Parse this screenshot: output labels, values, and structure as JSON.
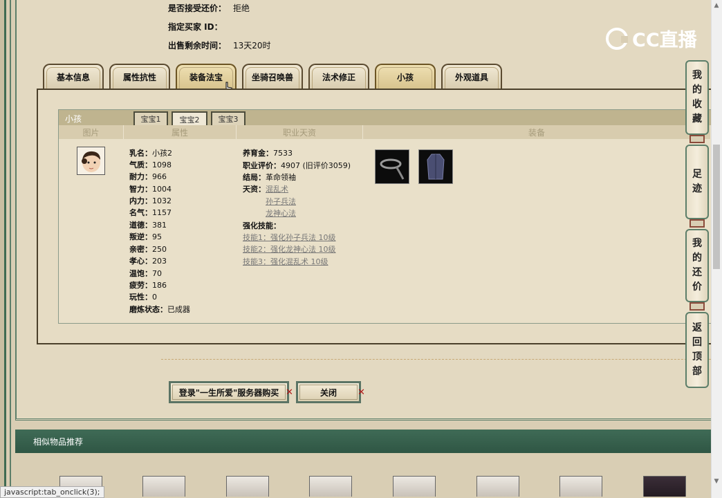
{
  "info": {
    "accept_counter_label": "是否接受还价：",
    "accept_counter_value": "拒绝",
    "buyer_id_label": "指定买家 ID：",
    "buyer_id_value": "",
    "time_left_label": "出售剩余时间：",
    "time_left_value": "13天20时"
  },
  "logo": {
    "text": "CC直播"
  },
  "tabs": [
    {
      "label": "基本信息",
      "active": false
    },
    {
      "label": "属性抗性",
      "active": false
    },
    {
      "label": "装备法宝",
      "active": true
    },
    {
      "label": "坐骑召唤兽",
      "active": false
    },
    {
      "label": "法术修正",
      "active": false
    },
    {
      "label": "小孩",
      "active": true
    },
    {
      "label": "外观道具",
      "active": false
    }
  ],
  "child_panel": {
    "title": "小孩",
    "subtabs": [
      {
        "label": "宝宝1",
        "active": false
      },
      {
        "label": "宝宝2",
        "active": true
      },
      {
        "label": "宝宝3",
        "active": false
      }
    ],
    "columns": [
      "图片",
      "属性",
      "职业天资",
      "装备"
    ],
    "attributes": [
      {
        "label": "乳名：",
        "value": "小孩2"
      },
      {
        "label": "气质：",
        "value": "1098"
      },
      {
        "label": "耐力：",
        "value": "966"
      },
      {
        "label": "智力：",
        "value": "1004"
      },
      {
        "label": "内力：",
        "value": "1032"
      },
      {
        "label": "名气：",
        "value": "1157"
      },
      {
        "label": "道德：",
        "value": "381"
      },
      {
        "label": "叛逆：",
        "value": "95"
      },
      {
        "label": "亲密：",
        "value": "250"
      },
      {
        "label": "孝心：",
        "value": "203"
      },
      {
        "label": "温饱：",
        "value": "70"
      },
      {
        "label": "疲劳：",
        "value": "186"
      },
      {
        "label": "玩性：",
        "value": "0"
      },
      {
        "label": "磨炼状态：",
        "value": "已成器"
      }
    ],
    "career": {
      "upbringing_label": "养育金：",
      "upbringing_value": "7533",
      "rating_label": "职业评价：",
      "rating_value": "4907 (旧评价3059)",
      "ending_label": "结局：",
      "ending_value": "革命领袖",
      "talent_label": "天资：",
      "talents": [
        "混乱术",
        "孙子兵法",
        "龙神心法"
      ],
      "skills_label": "强化技能：",
      "skills": [
        "技能1：强化孙子兵法 10级",
        "技能2：强化龙神心法 10级",
        "技能3：强化混乱术 10级"
      ]
    },
    "equipment": [
      {
        "icon": "belt-icon"
      },
      {
        "icon": "robe-icon"
      }
    ]
  },
  "buttons": {
    "login_buy": "登录\"一生所爱\"服务器购买",
    "close": "关闭"
  },
  "similar": {
    "title": "相似物品推荐"
  },
  "side_nav": [
    {
      "label": "我的收藏",
      "chars": [
        "我",
        "的",
        "收",
        "藏"
      ]
    },
    {
      "label": "足迹",
      "chars": [
        "足",
        "迹"
      ]
    },
    {
      "label": "我的还价",
      "chars": [
        "我",
        "的",
        "还",
        "价"
      ]
    },
    {
      "label": "返回顶部",
      "chars": [
        "返",
        "回",
        "顶",
        "部"
      ]
    }
  ],
  "status_bar": "javascript:tab_onclick(3);",
  "colors": {
    "frame_green": "#3f6b56",
    "panel_bg": "#e6dcc4",
    "link_gray": "#777777"
  }
}
